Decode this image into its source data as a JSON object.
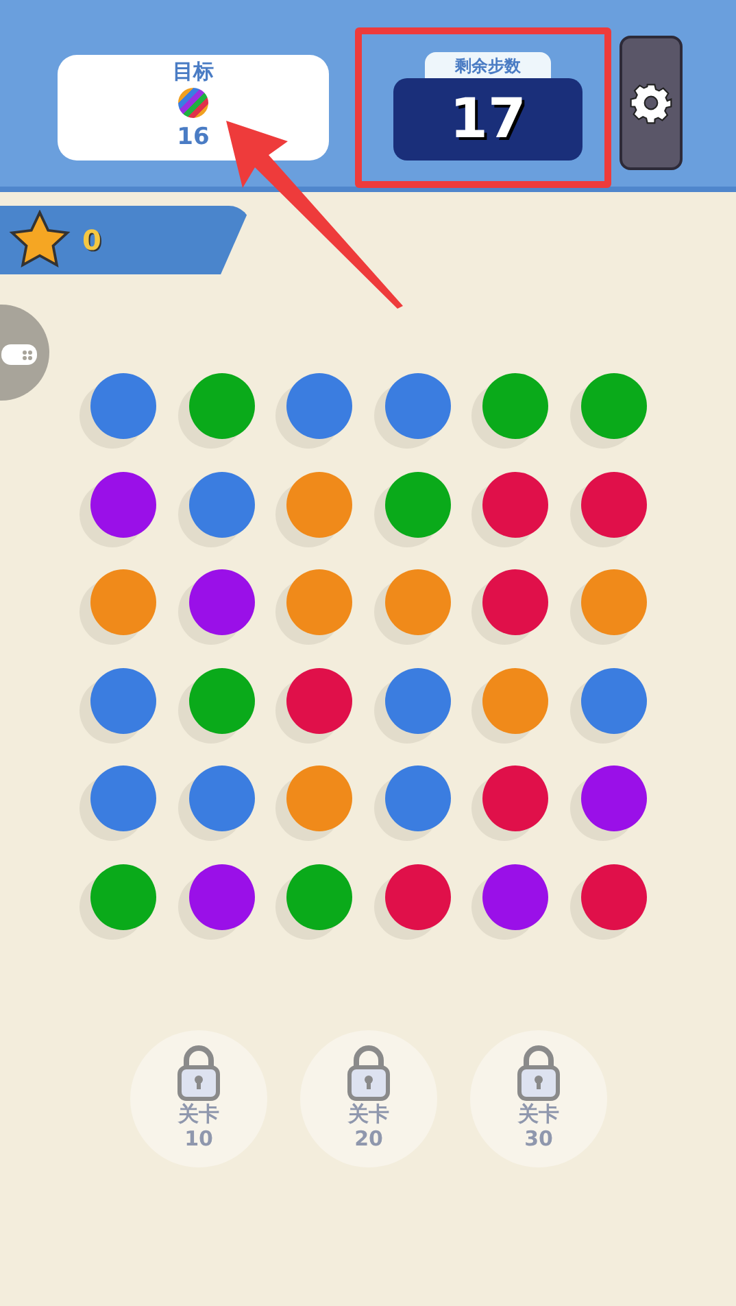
{
  "goal": {
    "label": "目标",
    "count": "16"
  },
  "moves": {
    "label": "剩余步数",
    "value": "17"
  },
  "stars": {
    "count": "0"
  },
  "board": {
    "rows": [
      {
        "balls": [
          {
            "color": "#3b7de0"
          },
          {
            "color": "#0aaa1a"
          },
          {
            "color": "#3b7de0"
          },
          {
            "color": "#3b7de0"
          },
          {
            "color": "#0aaa1a"
          },
          {
            "color": "#0aaa1a"
          }
        ]
      },
      {
        "balls": [
          {
            "color": "#9a10e8"
          },
          {
            "color": "#3b7de0"
          },
          {
            "color": "#f08a1a"
          },
          {
            "color": "#0aaa1a"
          },
          {
            "color": "#e0104a"
          },
          {
            "color": "#e0104a"
          }
        ]
      },
      {
        "balls": [
          {
            "color": "#f08a1a"
          },
          {
            "color": "#9a10e8"
          },
          {
            "color": "#f08a1a"
          },
          {
            "color": "#f08a1a"
          },
          {
            "color": "#e0104a"
          },
          {
            "color": "#f08a1a"
          }
        ]
      },
      {
        "balls": [
          {
            "color": "#3b7de0"
          },
          {
            "color": "#0aaa1a"
          },
          {
            "color": "#e0104a"
          },
          {
            "color": "#3b7de0"
          },
          {
            "color": "#f08a1a"
          },
          {
            "color": "#3b7de0"
          }
        ]
      },
      {
        "balls": [
          {
            "color": "#3b7de0"
          },
          {
            "color": "#3b7de0"
          },
          {
            "color": "#f08a1a"
          },
          {
            "color": "#3b7de0"
          },
          {
            "color": "#e0104a"
          },
          {
            "color": "#9a10e8"
          }
        ]
      },
      {
        "balls": [
          {
            "color": "#0aaa1a"
          },
          {
            "color": "#9a10e8"
          },
          {
            "color": "#0aaa1a"
          },
          {
            "color": "#e0104a"
          },
          {
            "color": "#9a10e8"
          },
          {
            "color": "#e0104a"
          }
        ]
      }
    ]
  },
  "levels": [
    {
      "label": "关卡",
      "number": "10",
      "locked": true
    },
    {
      "label": "关卡",
      "number": "20",
      "locked": true
    },
    {
      "label": "关卡",
      "number": "30",
      "locked": true
    }
  ]
}
